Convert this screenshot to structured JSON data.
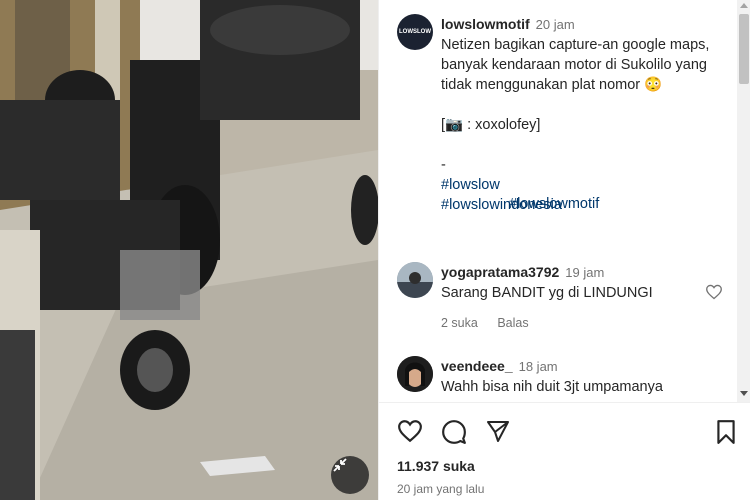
{
  "post": {
    "username": "lowslowmotif",
    "time": "20 jam",
    "avatar_text": "LOWSLOW",
    "caption_line1": "Netizen bagikan capture-an google maps, banyak kendaraan motor di Sukolilo yang tidak menggunakan plat nomor 😳",
    "caption_line2": "[📷 : xoxolofey]",
    "caption_line3": "-",
    "hashtags": [
      "#lowslow",
      "#lowslowmotif",
      "#lowslowindonesia"
    ]
  },
  "comments": [
    {
      "username": "yogapratama3792",
      "time": "19 jam",
      "text": "Sarang BANDIT yg di LINDUNGI",
      "likes": "2 suka",
      "reply": "Balas"
    },
    {
      "username": "veendeee_",
      "time": "18 jam",
      "text": "Wahh bisa nih duit 3jt umpamanya"
    }
  ],
  "footer": {
    "likes_count": "11.937 suka",
    "time_ago": "20 jam yang lalu"
  }
}
